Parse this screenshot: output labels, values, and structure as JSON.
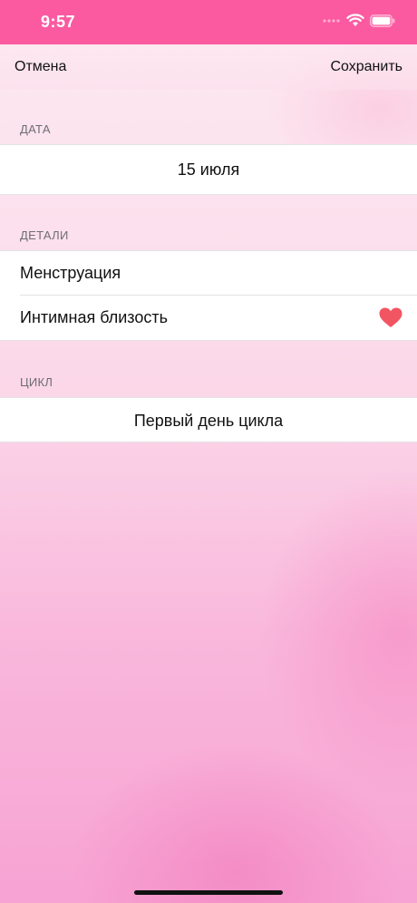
{
  "status_bar": {
    "time": "9:57",
    "icons": [
      "cellular-dots-icon",
      "wifi-icon",
      "battery-icon"
    ]
  },
  "nav": {
    "cancel_label": "Отмена",
    "save_label": "Сохранить"
  },
  "sections": {
    "date": {
      "header": "ДАТА",
      "value": "15 июля"
    },
    "details": {
      "header": "ДЕТАЛИ",
      "items": [
        {
          "label": "Менструация"
        },
        {
          "label": "Интимная близость",
          "icon": "heart-icon"
        }
      ]
    },
    "cycle": {
      "header": "ЦИКЛ",
      "value": "Первый день цикла"
    }
  },
  "colors": {
    "status_bar": "#fb5aa1",
    "heart": "#f25562",
    "background_top": "#fde8f0",
    "background_bottom": "#f7a3d3"
  }
}
